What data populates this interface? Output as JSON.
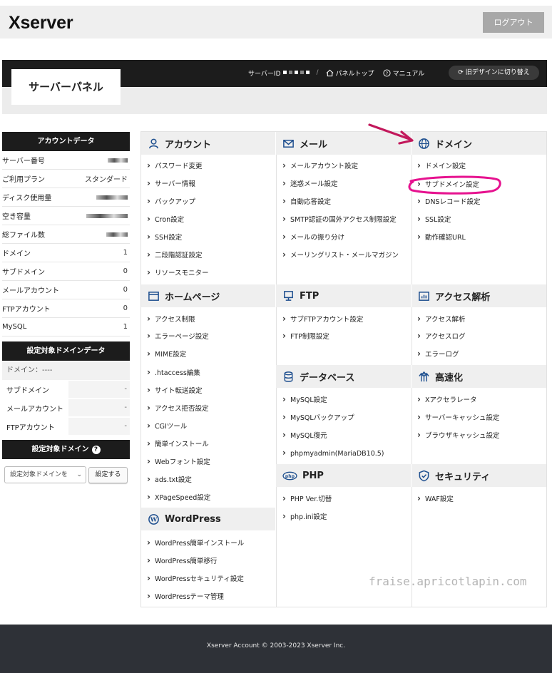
{
  "header": {
    "logo": "Xserver",
    "logout_label": "ログアウト"
  },
  "panel": {
    "title": "サーバーパネル",
    "server_id_label": "サーバーID",
    "panel_top_label": "パネルトップ",
    "manual_label": "マニュアル",
    "old_design_label": "旧デザインに切り替え"
  },
  "sidebar": {
    "account_head": "アカウントデータ",
    "account_rows": [
      {
        "label": "サーバー番号",
        "value": ""
      },
      {
        "label": "ご利用プラン",
        "value": "スタンダード"
      },
      {
        "label": "ディスク使用量",
        "value": ""
      },
      {
        "label": "空き容量",
        "value": ""
      },
      {
        "label": "総ファイル数",
        "value": ""
      },
      {
        "label": "ドメイン",
        "value": "1"
      },
      {
        "label": "サブドメイン",
        "value": "0"
      },
      {
        "label": "メールアカウント",
        "value": "0"
      },
      {
        "label": "FTPアカウント",
        "value": "0"
      },
      {
        "label": "MySQL",
        "value": "1"
      }
    ],
    "domain_data_head": "設定対象ドメインデータ",
    "domain_label": "ドメイン：----",
    "domain_rows": [
      {
        "label": "サブドメイン",
        "value": "-"
      },
      {
        "label": "メールアカウント",
        "value": "-"
      },
      {
        "label": "FTPアカウント",
        "value": "-"
      }
    ],
    "target_domain_head": "設定対象ドメイン",
    "select_value": "設定対象ドメインを",
    "set_button": "設定する"
  },
  "menu": {
    "account": {
      "title": "アカウント",
      "items": [
        "パスワード変更",
        "サーバー情報",
        "バックアップ",
        "Cron設定",
        "SSH設定",
        "二段階認証設定",
        "リソースモニター"
      ]
    },
    "mail": {
      "title": "メール",
      "items": [
        "メールアカウント設定",
        "迷惑メール設定",
        "自動応答設定",
        "SMTP認証の国外アクセス制限設定",
        "メールの振り分け",
        "メーリングリスト・メールマガジン"
      ]
    },
    "domain": {
      "title": "ドメイン",
      "items": [
        "ドメイン設定",
        "サブドメイン設定",
        "DNSレコード設定",
        "SSL設定",
        "動作確認URL"
      ]
    },
    "homepage": {
      "title": "ホームページ",
      "items": [
        "アクセス制限",
        "エラーページ設定",
        "MIME設定",
        ".htaccess編集",
        "サイト転送設定",
        "アクセス拒否設定",
        "CGIツール",
        "簡単インストール",
        "Webフォント設定",
        "ads.txt設定",
        "XPageSpeed設定"
      ]
    },
    "ftp": {
      "title": "FTP",
      "items": [
        "サブFTPアカウント設定",
        "FTP制限設定"
      ]
    },
    "access": {
      "title": "アクセス解析",
      "items": [
        "アクセス解析",
        "アクセスログ",
        "エラーログ"
      ]
    },
    "database": {
      "title": "データベース",
      "items": [
        "MySQL設定",
        "MySQLバックアップ",
        "MySQL復元",
        "phpmyadmin(MariaDB10.5)"
      ]
    },
    "speed": {
      "title": "高速化",
      "items": [
        "Xアクセラレータ",
        "サーバーキャッシュ設定",
        "ブラウザキャッシュ設定"
      ]
    },
    "php": {
      "title": "PHP",
      "items": [
        "PHP Ver.切替",
        "php.ini設定"
      ]
    },
    "security": {
      "title": "セキュリティ",
      "items": [
        "WAF設定"
      ]
    },
    "wordpress": {
      "title": "WordPress",
      "items": [
        "WordPress簡単インストール",
        "WordPress簡単移行",
        "WordPressセキュリティ設定",
        "WordPressテーマ管理"
      ]
    }
  },
  "watermark": "fraise.apricotlapin.com",
  "footer": "Xserver Account © 2003-2023 Xserver Inc.",
  "colors": {
    "dark": "#1c1c1c",
    "accent_arrow": "#c2185b",
    "highlight_circle": "#e6128f",
    "icon_blue": "#1e4f8f",
    "footer_bg": "#2e3137"
  }
}
